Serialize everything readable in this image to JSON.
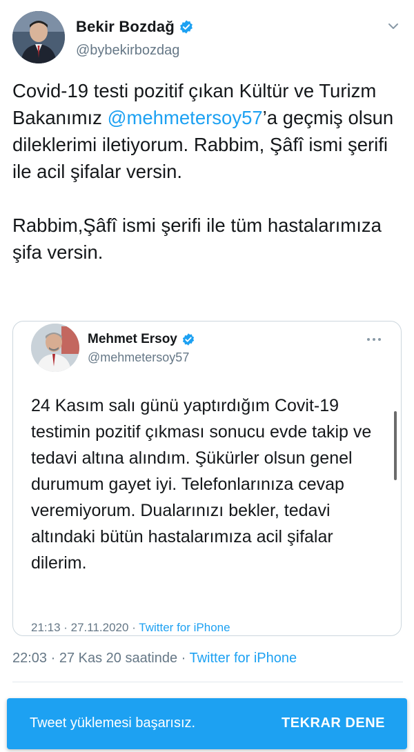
{
  "tweet": {
    "author_name": "Bekir  Bozdağ",
    "author_handle": "@bybekirbozdag",
    "text_part1": "Covid-19 testi pozitif çıkan Kültür ve Turizm Bakanımız ",
    "mention": "@mehmetersoy57",
    "text_part2": "’a geçmiş olsun dileklerimi iletiyorum. Rabbim, Şâfî ismi şerifi ile acil şifalar versin.\n\nRabbim,Şâfî ismi şerifi ile tüm hastalarımıza şifa versin.",
    "meta_time": "22:03 · 27 Kas 20 saatinde · ",
    "meta_source": "Twitter for iPhone"
  },
  "quoted_tweet": {
    "author_name": "Mehmet Ersoy",
    "author_handle": "@mehmetersoy57",
    "text": "24 Kasım salı günü yaptırdığım Covit-19 testimin pozitif çıkması sonucu evde takip ve tedavi altına alındım. Şükürler olsun genel durumum gayet iyi. Telefonlarınıza cevap veremiyorum. Dualarınızı bekler, tedavi altındaki bütün hastalarımıza acil şifalar dilerim.",
    "meta_time": "21:13 · 27.11.2020 · ",
    "meta_source": "Twitter for iPhone"
  },
  "snackbar": {
    "message": "Tweet yüklemesi başarısız.",
    "action": "TEKRAR DENE"
  },
  "icons": {
    "verified": "verified-badge-icon",
    "chevron": "chevron-down-icon",
    "more": "more-horizontal-icon"
  },
  "colors": {
    "accent": "#1da1f2",
    "secondary_text": "#657786",
    "primary_text": "#14171a"
  }
}
